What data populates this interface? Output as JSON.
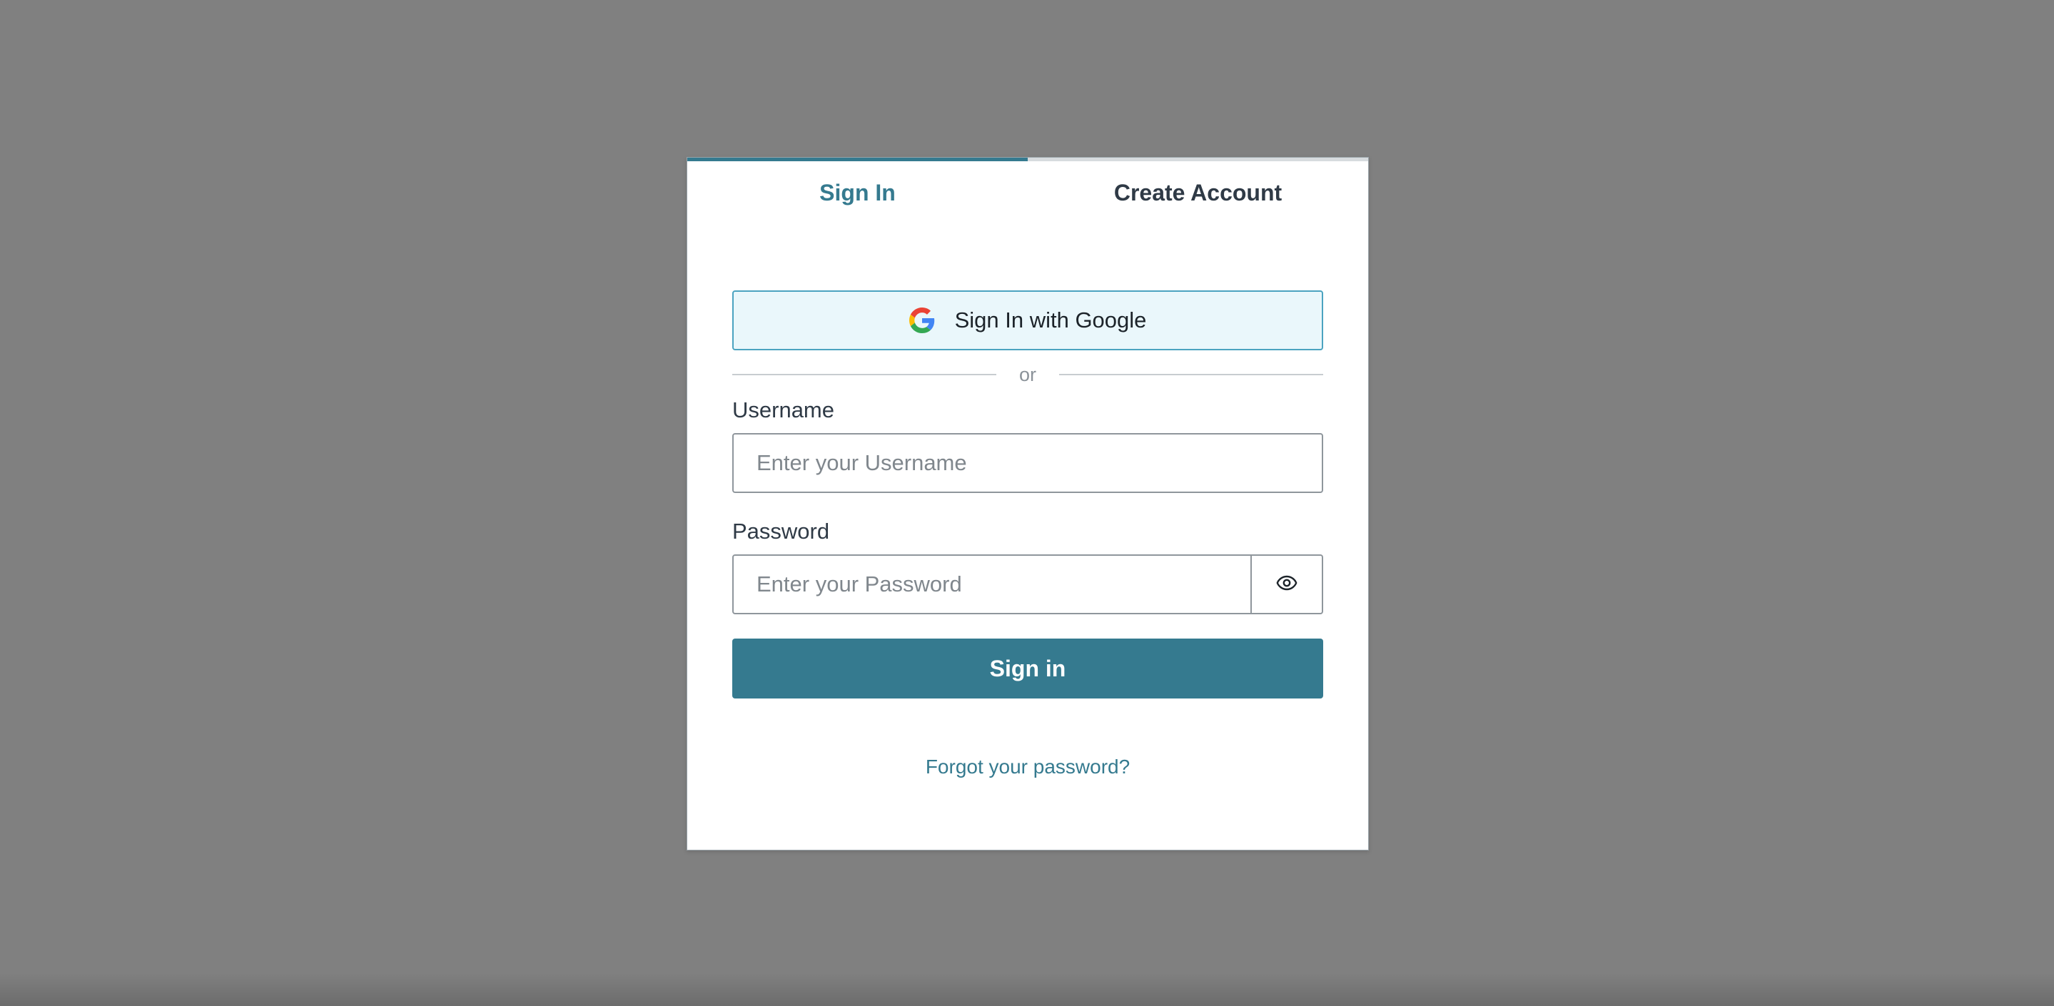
{
  "tabs": [
    {
      "label": "Sign In",
      "active": true
    },
    {
      "label": "Create Account",
      "active": false
    }
  ],
  "google": {
    "label": "Sign In with Google",
    "icon": "google-icon"
  },
  "divider": {
    "text": "or"
  },
  "username": {
    "label": "Username",
    "placeholder": "Enter your Username",
    "value": ""
  },
  "password": {
    "label": "Password",
    "placeholder": "Enter your Password",
    "value": "",
    "toggle_icon": "eye-icon"
  },
  "submit": {
    "label": "Sign in"
  },
  "forgot": {
    "label": "Forgot your password?"
  },
  "colors": {
    "accent": "#357a8f",
    "overlay": "#808080",
    "google_bg": "#eaf7fb"
  }
}
